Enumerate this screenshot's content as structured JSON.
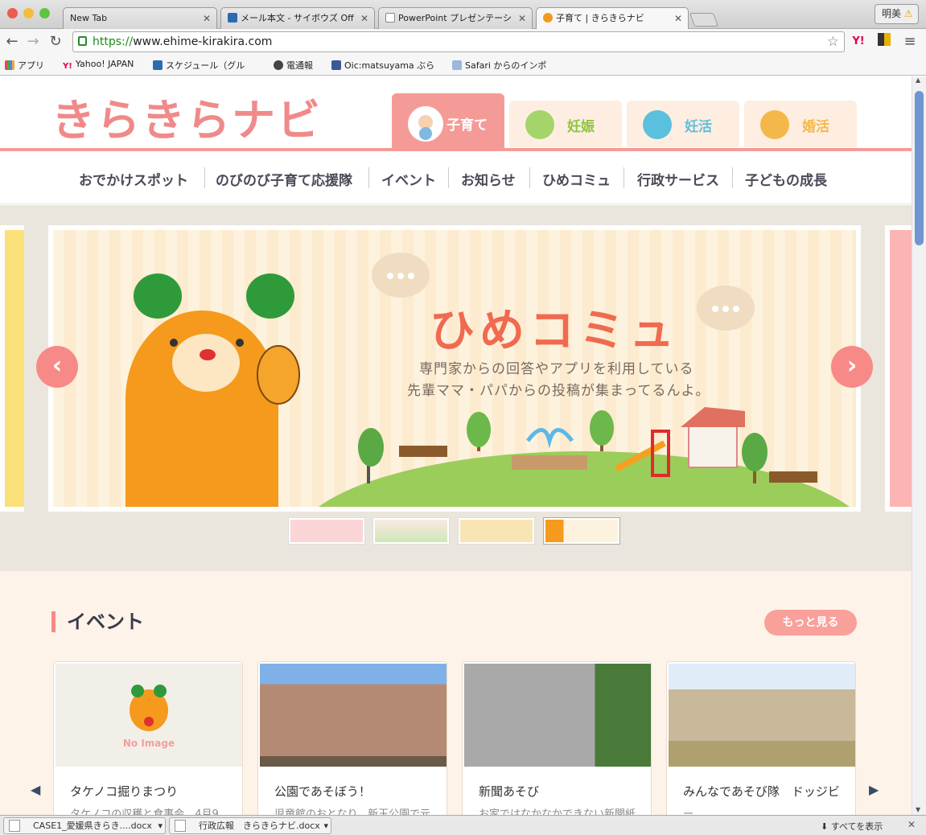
{
  "browser": {
    "tabs": [
      {
        "label": "New Tab"
      },
      {
        "label": "メール本文 - サイボウズ Off"
      },
      {
        "label": "PowerPoint プレゼンテーシ"
      },
      {
        "label": "子育て | きらきらナビ"
      }
    ],
    "profile_name": "明美",
    "url_scheme": "https://",
    "url_rest": "www.ehime-kirakira.com",
    "bookmarks": [
      "アプリ",
      "Yahoo! JAPAN",
      "スケジュール（グル",
      "電通報",
      "Oic:matsuyama ぶら",
      "Safari からのインポ"
    ]
  },
  "site": {
    "logo": "きらきらナビ",
    "category_tabs": [
      {
        "label": "子育て",
        "active": true
      },
      {
        "label": "妊娠",
        "active": false
      },
      {
        "label": "妊活",
        "active": false
      },
      {
        "label": "婚活",
        "active": false
      }
    ],
    "nav": [
      "おでかけスポット",
      "のびのび子育て応援隊",
      "イベント",
      "お知らせ",
      "ひめコミュ",
      "行政サービス",
      "子どもの成長"
    ],
    "slide": {
      "heading": "ひめコミュ",
      "line1": "専門家からの回答やアプリを利用している",
      "line2": "先輩ママ・パパからの投稿が集まってるんよ。"
    },
    "events": {
      "title": "イベント",
      "more_label": "もっと見る",
      "no_image": "No Image",
      "cards": [
        {
          "title": "タケノコ掘りまつり",
          "desc": "タケノコの収穫と食事会　4月9"
        },
        {
          "title": "公園であそぼう！",
          "desc": "児童館のおとなり、新玉公園で元"
        },
        {
          "title": "新聞あそび",
          "desc": "お家ではなかなかできない新聞紙"
        },
        {
          "title": "みんなであそび隊　ドッジビ",
          "desc": "ー"
        }
      ]
    }
  },
  "downloads": {
    "items": [
      "CASE1_愛媛県きらき....docx",
      "行政広報　きらきらナビ.docx"
    ],
    "show_all": "すべてを表示"
  },
  "colors": {
    "accent": "#f78a86",
    "pink_tab": "#f59b97",
    "green": "#8dc63f"
  }
}
